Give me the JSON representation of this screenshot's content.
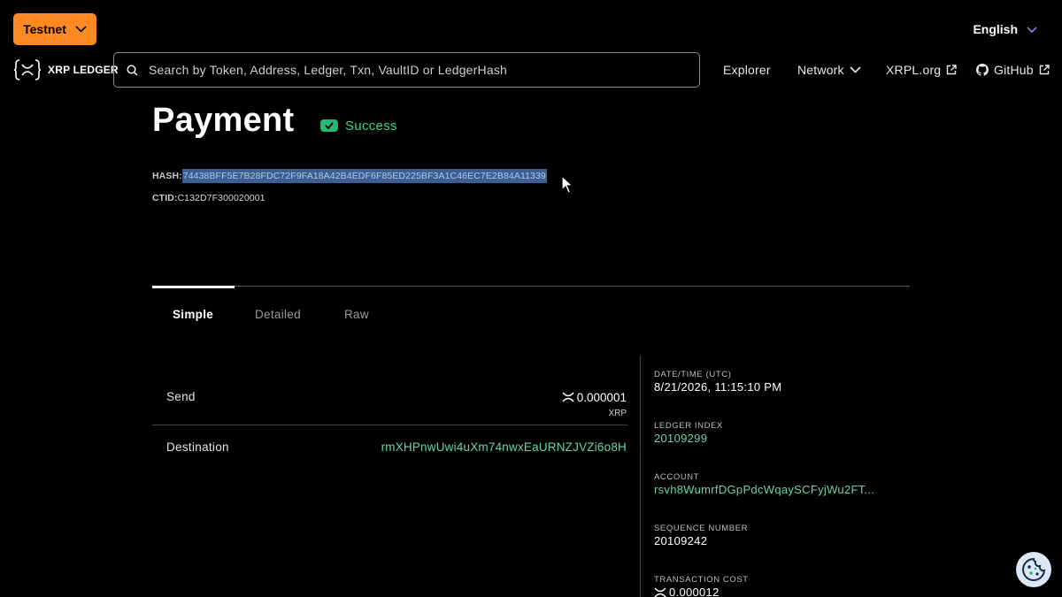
{
  "header": {
    "network_button": "Testnet",
    "language": "English",
    "logo_text": "XRP LEDGER",
    "search_placeholder": "Search by Token, Address, Ledger, Txn, VaultID or LedgerHash",
    "nav": {
      "explorer": "Explorer",
      "network": "Network",
      "xrpl": "XRPL.org",
      "github": "GitHub"
    }
  },
  "transaction": {
    "type": "Payment",
    "status": "Success",
    "hash_label": "HASH:",
    "hash": "74438BFF5E7B28FDC72F9FA18A42B4EDF6F85ED225BF3A1C46EC7E2B84A11339",
    "ctid_label": "CTID:",
    "ctid": "C132D7F300020001"
  },
  "tabs": [
    "Simple",
    "Detailed",
    "Raw"
  ],
  "simple": {
    "send_label": "Send",
    "send_amount": "0.000001",
    "send_currency": "XRP",
    "destination_label": "Destination",
    "destination": "rmXHPnwUwi4uXm74nwxEaURNZJVZi6o8H"
  },
  "meta": {
    "datetime_label": "DATE/TIME (UTC)",
    "datetime": "8/21/2026, 11:15:10 PM",
    "ledger_index_label": "LEDGER INDEX",
    "ledger_index": "20109299",
    "account_label": "ACCOUNT",
    "account": "rsvh8WumrfDGpPdcWqaySCFyjWu2FT...",
    "sequence_label": "SEQUENCE NUMBER",
    "sequence": "20109242",
    "cost_label": "TRANSACTION COST",
    "cost": "0.000012"
  },
  "colors": {
    "accent_orange": "#ff8a24",
    "success_green": "#3fd68d",
    "link_green": "#6cd4a4",
    "selection_blue": "#3a5f95"
  }
}
